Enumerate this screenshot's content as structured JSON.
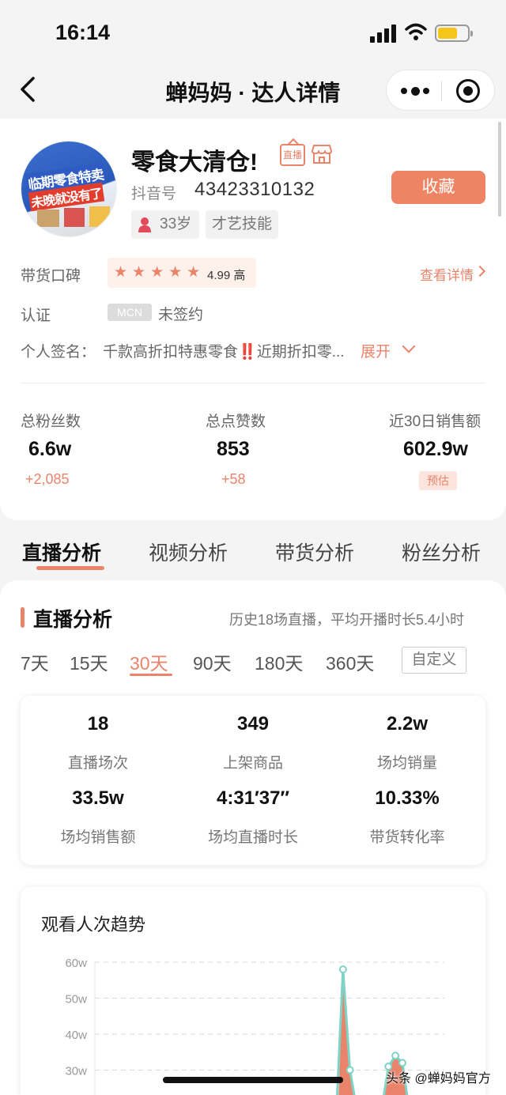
{
  "status": {
    "time": "16:14"
  },
  "nav": {
    "title": "蝉妈妈 · 达人详情"
  },
  "profile": {
    "name": "零食大清仓!",
    "live_badge": "直播",
    "avatar_text_1": "临期零食特卖",
    "avatar_text_2": "未晚就没有了",
    "douyin_label": "抖音号",
    "douyin_id": "43423310132",
    "favorite_button": "收藏",
    "tags": {
      "age": "33岁",
      "skill": "才艺技能"
    },
    "reputation_label": "带货口碑",
    "rating_stars": "★★★★★",
    "rating_score": "4.99 高",
    "rating_value": 4.99,
    "detail_link": "查看详情",
    "cert_label": "认证",
    "cert_badge": "MCN",
    "cert_value": "未签约",
    "signature_label": "个人签名：",
    "signature_pre": "千款高折扣特惠零食",
    "signature_emoji": "‼️",
    "signature_post": "近期折扣零...",
    "expand": "展开"
  },
  "stats": {
    "fans": {
      "label": "总粉丝数",
      "value": "6.6w",
      "delta": "+2,085"
    },
    "likes": {
      "label": "总点赞数",
      "value": "853",
      "delta": "+58"
    },
    "sales": {
      "label": "近30日销售额",
      "value": "602.9w",
      "badge": "预估"
    }
  },
  "tabs": [
    "直播分析",
    "视频分析",
    "带货分析",
    "粉丝分析"
  ],
  "section": {
    "title": "直播分析",
    "subtitle": "历史18场直播，平均开播时长5.4小时",
    "ranges": [
      "7天",
      "15天",
      "30天",
      "90天",
      "180天",
      "360天"
    ],
    "active_range": "30天",
    "custom": "自定义"
  },
  "metrics": [
    {
      "value": "18",
      "label": "直播场次"
    },
    {
      "value": "349",
      "label": "上架商品"
    },
    {
      "value": "2.2w",
      "label": "场均销量"
    },
    {
      "value": "33.5w",
      "label": "场均销售额"
    },
    {
      "value": "4:31′37′′",
      "label": "场均直播时长"
    },
    {
      "value": "10.33%",
      "label": "带货转化率"
    }
  ],
  "chart_title": "观看人次趋势",
  "chart_data": {
    "type": "line",
    "title": "观看人次趋势",
    "y_ticks": [
      "60w",
      "50w",
      "40w",
      "30w"
    ],
    "ylim_visible": [
      30,
      60
    ],
    "series": [
      {
        "points": [
          [
            0.71,
            58
          ],
          [
            0.73,
            30
          ]
        ]
      },
      {
        "points": [
          [
            0.84,
            31
          ],
          [
            0.86,
            34
          ],
          [
            0.88,
            32
          ]
        ]
      }
    ],
    "colors": {
      "line": "#7fd3c6",
      "fill": "#e9846a"
    }
  },
  "watermark": "头条 @蝉妈妈官方",
  "colors": {
    "accent": "#e9846a",
    "button": "#ee8463"
  }
}
